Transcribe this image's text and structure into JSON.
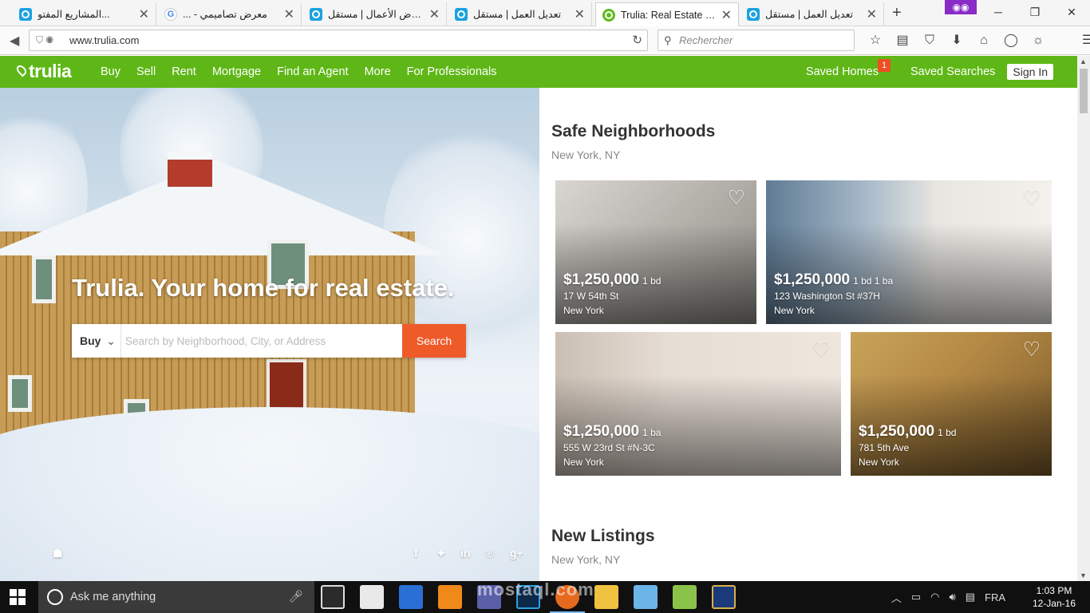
{
  "browser": {
    "tabs": [
      {
        "title": "المشاريع المفتو...",
        "icon": "mostaql-icon",
        "close": "✕"
      },
      {
        "title": "... - معرض تصاميمي",
        "icon": "google-icon",
        "close": "✕"
      },
      {
        "title": "معرض الأعمال | مستقل",
        "icon": "mostaql-icon",
        "close": "✕"
      },
      {
        "title": "تعديل العمل | مستقل",
        "icon": "mostaql-icon",
        "close": "✕"
      },
      {
        "title": "Trulia: Real Estate Lis...",
        "icon": "trulia-icon",
        "close": "✕",
        "active": true
      },
      {
        "title": "تعديل العمل | مستقل",
        "icon": "mostaql-icon",
        "close": "✕"
      }
    ],
    "new_tab": "+",
    "url": "www.trulia.com",
    "search_placeholder": "Rechercher"
  },
  "header": {
    "logo": "trulia",
    "nav": [
      "Buy",
      "Sell",
      "Rent",
      "Mortgage",
      "Find an Agent",
      "More",
      "For Professionals"
    ],
    "saved_homes": "Saved Homes",
    "saved_homes_count": "1",
    "saved_searches": "Saved Searches",
    "sign_in": "Sign In"
  },
  "hero": {
    "title": "Trulia. Your home for real estate.",
    "mode": "Buy",
    "placeholder": "Search by Neighborhood, City, or Address",
    "search_button": "Search"
  },
  "sections": {
    "safe": {
      "title": "Safe Neighborhoods",
      "subtitle": "New York, NY",
      "listings": [
        {
          "price": "$1,250,000",
          "beds": "1 bd",
          "address": "17 W 54th St",
          "city": "New York"
        },
        {
          "price": "$1,250,000",
          "beds": "1 bd 1 ba",
          "address": "123 Washington St #37H",
          "city": "New York"
        },
        {
          "price": "$1,250,000",
          "beds": "1 ba",
          "address": "555 W 23rd St #N-3C",
          "city": "New York"
        },
        {
          "price": "$1,250,000",
          "beds": "1 bd",
          "address": "781 5th Ave",
          "city": "New York"
        }
      ]
    },
    "new": {
      "title": "New Listings",
      "subtitle": "New York, NY"
    }
  },
  "taskbar": {
    "search": "Ask me anything",
    "lang": "FRA",
    "time": "1:03 PM",
    "date": "12-Jan-16"
  },
  "watermark": "mostaql.com",
  "colors": {
    "brand_green": "#5eb716",
    "search_orange": "#ef5a29",
    "badge_red": "#ef4d23"
  }
}
